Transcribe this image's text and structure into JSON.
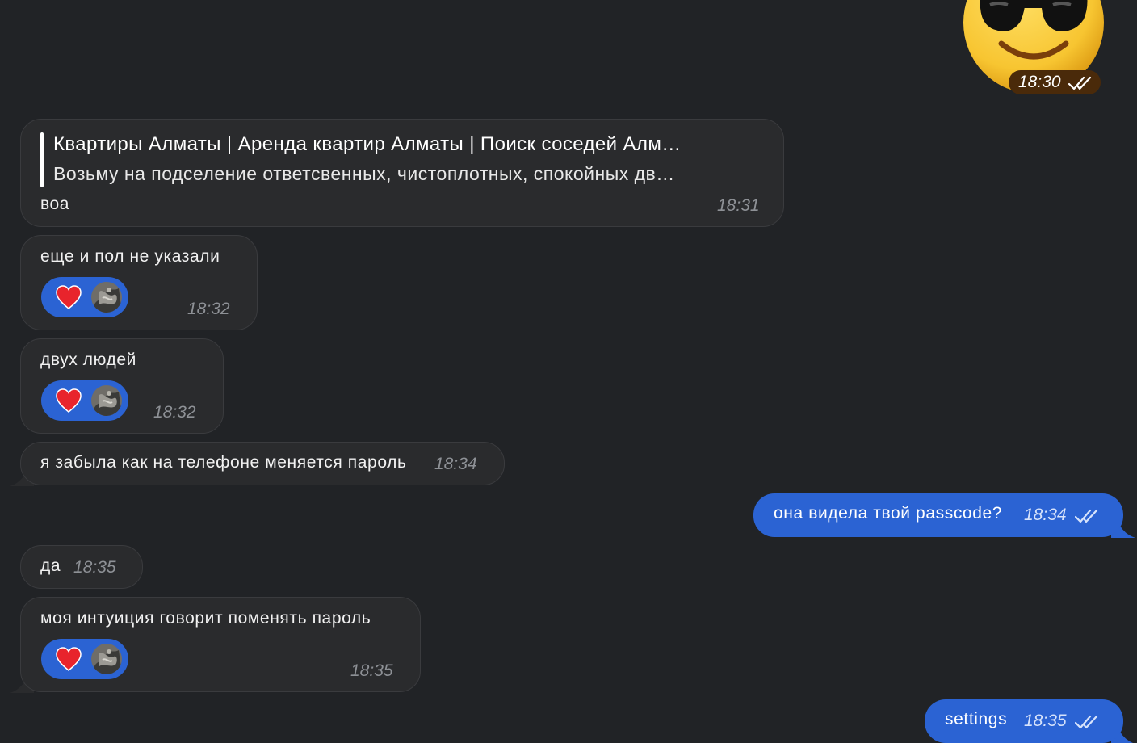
{
  "sticker": {
    "emoji": "sunglasses-face",
    "time": "18:30"
  },
  "messages": [
    {
      "reply_title": "Квартиры Алматы | Аренда квартир Алматы | Поиск соседей Алм…",
      "reply_text": "Возьму на подселение ответсвенных, чистоплотных, спокойных  дв…",
      "text": "воа",
      "time": "18:31"
    },
    {
      "text": "еще и пол не указали",
      "time": "18:32",
      "reaction": "heart"
    },
    {
      "text": "двух людей",
      "time": "18:32",
      "reaction": "heart"
    },
    {
      "text": "я забыла как на телефоне меняется пароль",
      "time": "18:34"
    },
    {
      "text": "она видела твой passcode?",
      "time": "18:34"
    },
    {
      "text": "да",
      "time": "18:35"
    },
    {
      "text": "моя интуиция говорит поменять пароль",
      "time": "18:35",
      "reaction": "heart"
    },
    {
      "text": "settings",
      "time": "18:35"
    }
  ],
  "colors": {
    "background": "#212326",
    "incoming_bubble": "#2a2b2d",
    "outgoing_bubble": "#2b63d3",
    "reaction_pill": "#2b63d3",
    "heart": "#e8242c"
  }
}
